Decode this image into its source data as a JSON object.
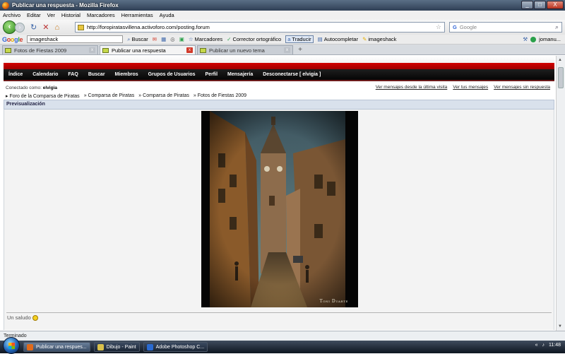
{
  "window": {
    "title": "Publicar una respuesta - Mozilla Firefox",
    "min_label": "_",
    "max_label": "□",
    "close_label": "X"
  },
  "menu": [
    "Archivo",
    "Editar",
    "Ver",
    "Historial",
    "Marcadores",
    "Herramientas",
    "Ayuda"
  ],
  "nav": {
    "url": "http://foropiratasvillena.activoforo.com/posting.forum",
    "search_placeholder": "Google"
  },
  "google_toolbar": {
    "logo": "Google",
    "query": "imageshack",
    "buscar": "Buscar",
    "marcadores": "Marcadores",
    "corrector": "Corrector ortográfico",
    "traducir": "Traducir",
    "autocompletar": "Autocompletar",
    "imageshack": "imageshack",
    "user": "jomanu..."
  },
  "tabs": [
    {
      "label": "Fotos de Fiestas 2009"
    },
    {
      "label": "Publicar una respuesta"
    },
    {
      "label": "Publicar un nuevo tema"
    }
  ],
  "forum": {
    "nav_items": [
      "Índice",
      "Calendario",
      "FAQ",
      "Buscar",
      "Miembros",
      "Grupos de Usuarios",
      "Perfil",
      "Mensajería",
      "Desconectarse [ elvigia ]"
    ],
    "logged_prefix": "Conectado como:",
    "logged_user": "elvigia",
    "quick_links": [
      "Ver mensajes desde la última visita",
      "Ver tus mensajes",
      "Ver mensajes sin respuesta"
    ],
    "breadcrumb": [
      "Foro de la Comparsa de Piratas",
      "Comparsa de Piratas",
      "Comparsa de Piratas",
      "Fotos de Fiestas 2009"
    ],
    "preview_header": "Previsualización",
    "photo_watermark": "Toni Duarte",
    "message": "Un saludo"
  },
  "status": "Terminado",
  "taskbar": {
    "tasks": [
      {
        "label": "Publicar una respues...",
        "color": "#e06a1a"
      },
      {
        "label": "Dibujo - Paint",
        "color": "#d9c04a"
      },
      {
        "label": "Adobe Photoshop C...",
        "color": "#2a6ad0"
      }
    ],
    "clock": "11:48"
  }
}
